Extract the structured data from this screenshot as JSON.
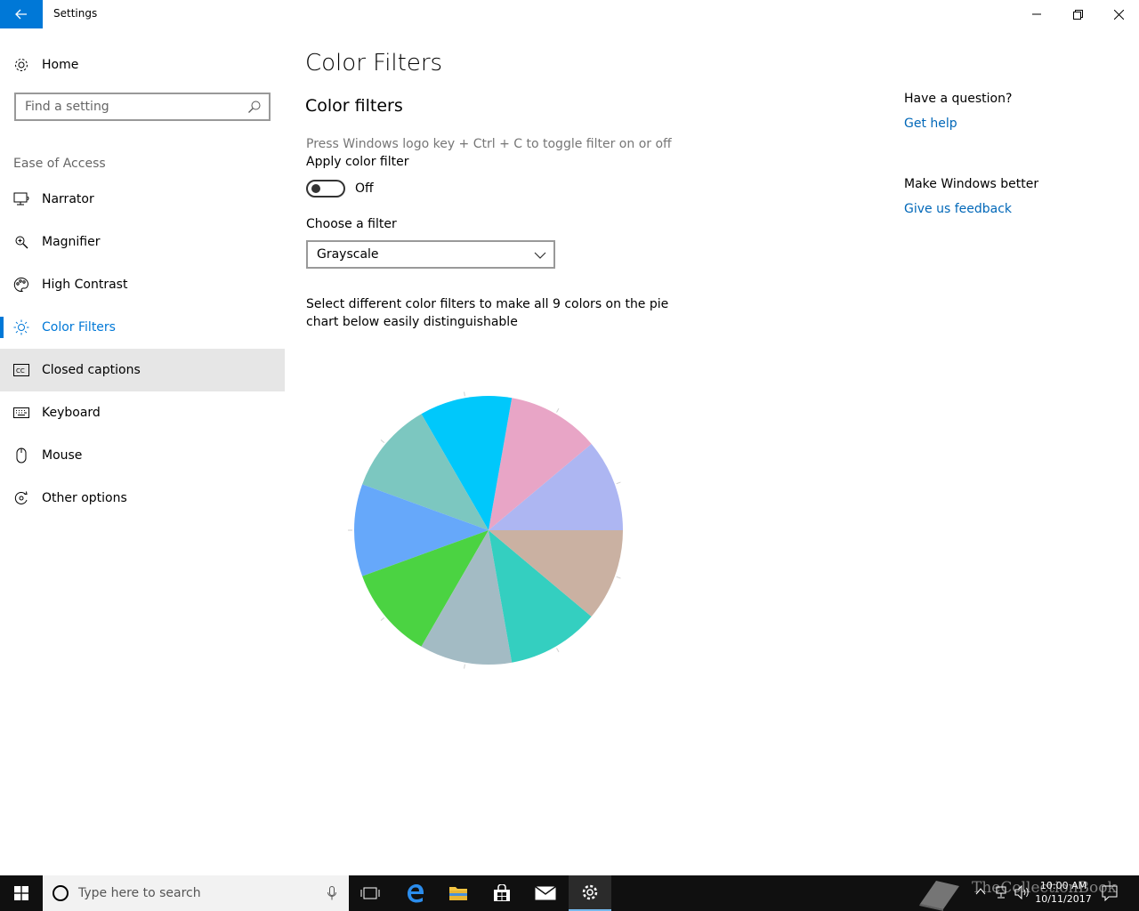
{
  "window": {
    "title": "Settings"
  },
  "sidebar": {
    "home_label": "Home",
    "search_placeholder": "Find a setting",
    "section_label": "Ease of Access",
    "items": [
      {
        "label": "Narrator",
        "icon": "narrator-icon"
      },
      {
        "label": "Magnifier",
        "icon": "magnifier-icon"
      },
      {
        "label": "High Contrast",
        "icon": "palette-icon"
      },
      {
        "label": "Color Filters",
        "icon": "sun-icon",
        "selected": true
      },
      {
        "label": "Closed captions",
        "icon": "cc-icon"
      },
      {
        "label": "Keyboard",
        "icon": "keyboard-icon"
      },
      {
        "label": "Mouse",
        "icon": "mouse-icon"
      },
      {
        "label": "Other options",
        "icon": "other-options-icon"
      }
    ]
  },
  "main": {
    "page_title": "Color Filters",
    "sub_title": "Color filters",
    "hint": "Press Windows logo key + Ctrl + C to toggle filter on or off",
    "apply_label": "Apply color filter",
    "toggle_state": "Off",
    "choose_label": "Choose a filter",
    "filter_selected": "Grayscale",
    "description": "Select different color filters to make all 9 colors on the pie chart below easily distinguishable"
  },
  "right": {
    "question": "Have a question?",
    "help_link": "Get help",
    "better": "Make Windows better",
    "feedback_link": "Give us feedback"
  },
  "taskbar": {
    "search_placeholder": "Type here to search",
    "time": "10:00 AM",
    "date": "10/11/2017",
    "watermark": "TheCollectionBook"
  },
  "chart_data": {
    "type": "pie",
    "values": [
      1,
      1,
      1,
      1,
      1,
      1,
      1,
      1,
      1
    ],
    "colors": [
      "#adb6f2",
      "#e8a5c6",
      "#00c8fb",
      "#7cc7c0",
      "#66a8fa",
      "#4bd342",
      "#a3bbc4",
      "#34cfc0",
      "#cab1a2"
    ],
    "start": "east",
    "direction": "counterclockwise"
  },
  "colors": {
    "accent": "#0078d7",
    "link": "#0067b8"
  }
}
